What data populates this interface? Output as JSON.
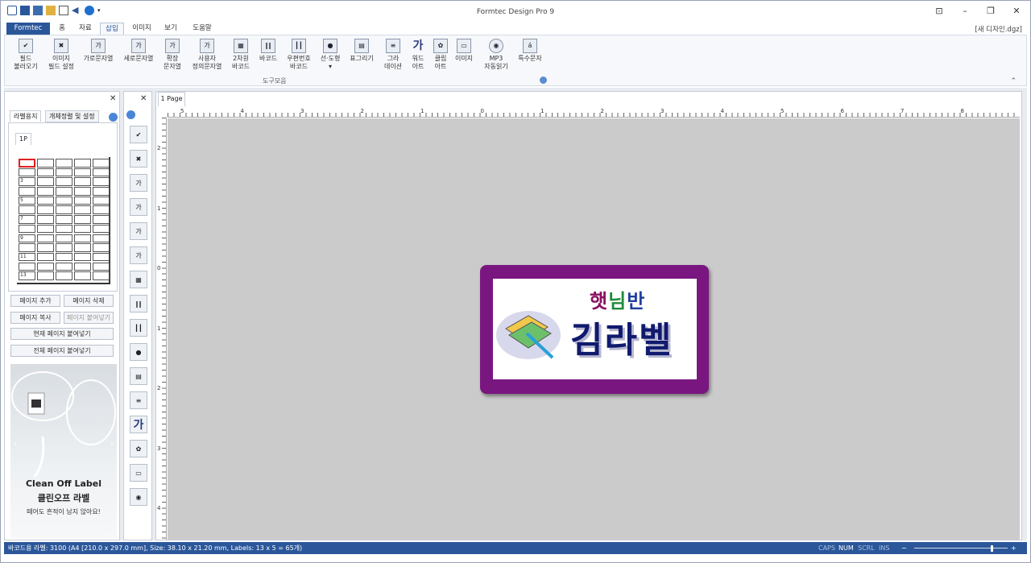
{
  "app": {
    "title": "Formtec Design Pro 9",
    "document": "[새 디자인.dgz]"
  },
  "tabs": [
    {
      "label": "Formtec"
    },
    {
      "label": "홈"
    },
    {
      "label": "자료"
    },
    {
      "label": "삽입"
    },
    {
      "label": "이미지"
    },
    {
      "label": "보기"
    },
    {
      "label": "도움말"
    }
  ],
  "ribbon": {
    "group_label": "도구모음",
    "buttons": [
      {
        "l1": "필드",
        "l2": "불러오기",
        "icon": "field-load-icon"
      },
      {
        "l1": "이미지",
        "l2": "필드 설정",
        "icon": "image-field-icon"
      },
      {
        "l1": "가로문자열",
        "l2": "",
        "icon": "horizontal-text-icon"
      },
      {
        "l1": "세로문자열",
        "l2": "",
        "icon": "vertical-text-icon"
      },
      {
        "l1": "확장",
        "l2": "문자열",
        "icon": "extended-text-icon"
      },
      {
        "l1": "사용자",
        "l2": "정의문자열",
        "icon": "custom-text-icon"
      },
      {
        "l1": "2차원",
        "l2": "바코드",
        "icon": "qr-code-icon"
      },
      {
        "l1": "바코드",
        "l2": "",
        "icon": "barcode-icon"
      },
      {
        "l1": "우편번호",
        "l2": "바코드",
        "icon": "postal-barcode-icon"
      },
      {
        "l1": "선·도형",
        "l2": "▾",
        "icon": "shape-icon"
      },
      {
        "l1": "표그리기",
        "l2": "",
        "icon": "table-icon"
      },
      {
        "l1": "그라",
        "l2": "데이션",
        "icon": "gradation-icon"
      },
      {
        "l1": "워드",
        "l2": "아트",
        "icon": "wordart-icon"
      },
      {
        "l1": "클립",
        "l2": "아트",
        "icon": "clipart-icon"
      },
      {
        "l1": "이미지",
        "l2": "",
        "icon": "image-icon"
      },
      {
        "l1": "MP3",
        "l2": "자동읽기",
        "icon": "mp3-icon"
      },
      {
        "l1": "특수문자",
        "l2": "",
        "icon": "special-char-icon"
      }
    ]
  },
  "left_panel": {
    "tabs": [
      "라벨용지",
      "개체정렬 및 설정"
    ],
    "page_tab": "1P",
    "cell_numbers": [
      "3",
      "5",
      "7",
      "9",
      "11",
      "13"
    ],
    "buttons": {
      "add": "페이지 추가",
      "delete": "페이지 삭제",
      "copy": "페이지 복사",
      "paste": "페이지 붙여넣기",
      "paste_current": "현재 페이지 붙여넣기",
      "paste_all": "전체 페이지 붙여넣기"
    },
    "ad": {
      "brand": "Clean Off Label",
      "name": "클린오프 라벨",
      "tagline": "떼어도 흔적이 남지 않아요!"
    }
  },
  "canvas": {
    "page_tab": "1 Page",
    "hruler_labels": [
      "5",
      "4",
      "3",
      "2",
      "1",
      "0",
      "1",
      "2",
      "3",
      "4",
      "5",
      "6",
      "7",
      "8"
    ],
    "vruler_labels": [
      "2",
      "1",
      "0",
      "1",
      "2",
      "3",
      "4"
    ],
    "label_small": "햇님반",
    "label_big": "김라벨",
    "colors": {
      "frame": "#7a1680",
      "small_1": "#8a1060",
      "small_2": "#1f8a3a",
      "small_3": "#1f3f9a",
      "big": "#101a6e"
    }
  },
  "status": {
    "text": "바코드용 라벨: 3100 (A4 [210.0 x 297.0 mm], Size: 38.10 x 21.20 mm,  Labels: 13 x 5 = 65개)",
    "caps": "CAPS",
    "num": "NUM",
    "scrl": "SCRL",
    "ins": "INS",
    "zoom_minus": "−",
    "zoom_plus": "+"
  }
}
